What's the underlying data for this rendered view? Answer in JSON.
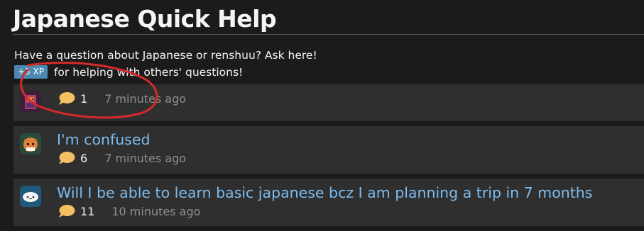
{
  "page": {
    "title": "Japanese Quick Help",
    "intro": "Have a question about Japanese or renshuu? Ask here!",
    "xp_badge": "+3 XP",
    "xp_text": "for helping with others' questions!"
  },
  "threads": [
    {
      "title": "",
      "replies": "1",
      "time": "7 minutes ago",
      "avatar": "pixel-art-avatar"
    },
    {
      "title": "I'm confused",
      "replies": "6",
      "time": "7 minutes ago",
      "avatar": "orange-cat-avatar"
    },
    {
      "title": "Will I be able to learn basic japanese bcz I am planning a trip in 7 months",
      "replies": "11",
      "time": "10 minutes ago",
      "avatar": "cloud-face-avatar"
    }
  ],
  "colors": {
    "background": "#1b1b1b",
    "panel": "#2f2f2f",
    "link": "#7cbcef",
    "badge": "#4a8ab0",
    "bubble": "#f4c062",
    "annotation": "#d42a2a"
  }
}
